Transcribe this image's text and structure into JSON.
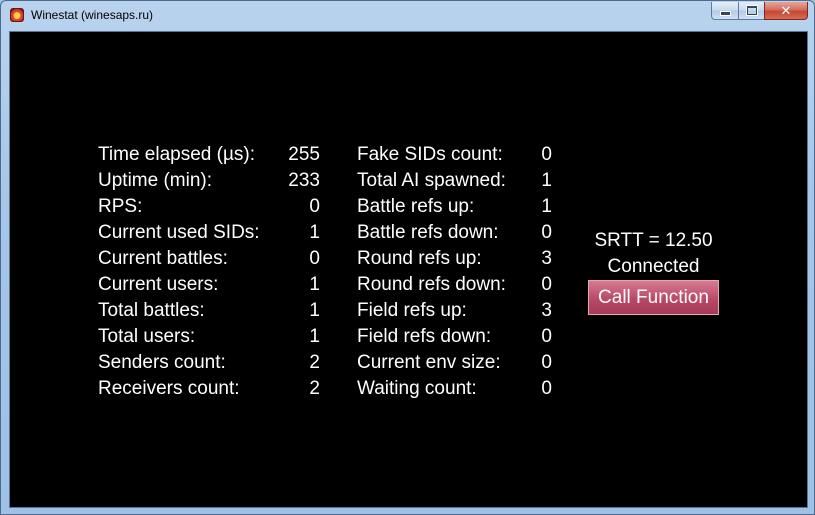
{
  "window": {
    "title": "Winestat (winesaps.ru)",
    "buttons": {
      "minimize": "minimize",
      "maximize": "maximize",
      "close": "✕"
    }
  },
  "stats_left": [
    {
      "label": "Time elapsed (µs):",
      "value": "255"
    },
    {
      "label": "Uptime (min):",
      "value": "233"
    },
    {
      "label": "RPS:",
      "value": "0"
    },
    {
      "label": "Current used SIDs:",
      "value": "1"
    },
    {
      "label": "Current battles:",
      "value": "0"
    },
    {
      "label": "Current users:",
      "value": "1"
    },
    {
      "label": "Total battles:",
      "value": "1"
    },
    {
      "label": "Total users:",
      "value": "1"
    },
    {
      "label": "Senders count:",
      "value": "2"
    },
    {
      "label": "Receivers count:",
      "value": "2"
    }
  ],
  "stats_right": [
    {
      "label": "Fake SIDs count:",
      "value": "0"
    },
    {
      "label": "Total AI spawned:",
      "value": "1"
    },
    {
      "label": "Battle refs up:",
      "value": "1"
    },
    {
      "label": "Battle refs down:",
      "value": "0"
    },
    {
      "label": "Round refs up:",
      "value": "3"
    },
    {
      "label": "Round refs down:",
      "value": "0"
    },
    {
      "label": "Field refs up:",
      "value": "3"
    },
    {
      "label": "Field refs down:",
      "value": "0"
    },
    {
      "label": "Current env size:",
      "value": "0"
    },
    {
      "label": "Waiting count:",
      "value": "0"
    }
  ],
  "connection": {
    "srtt": "SRTT = 12.50",
    "state": "Connected",
    "call_button": "Call Function"
  }
}
